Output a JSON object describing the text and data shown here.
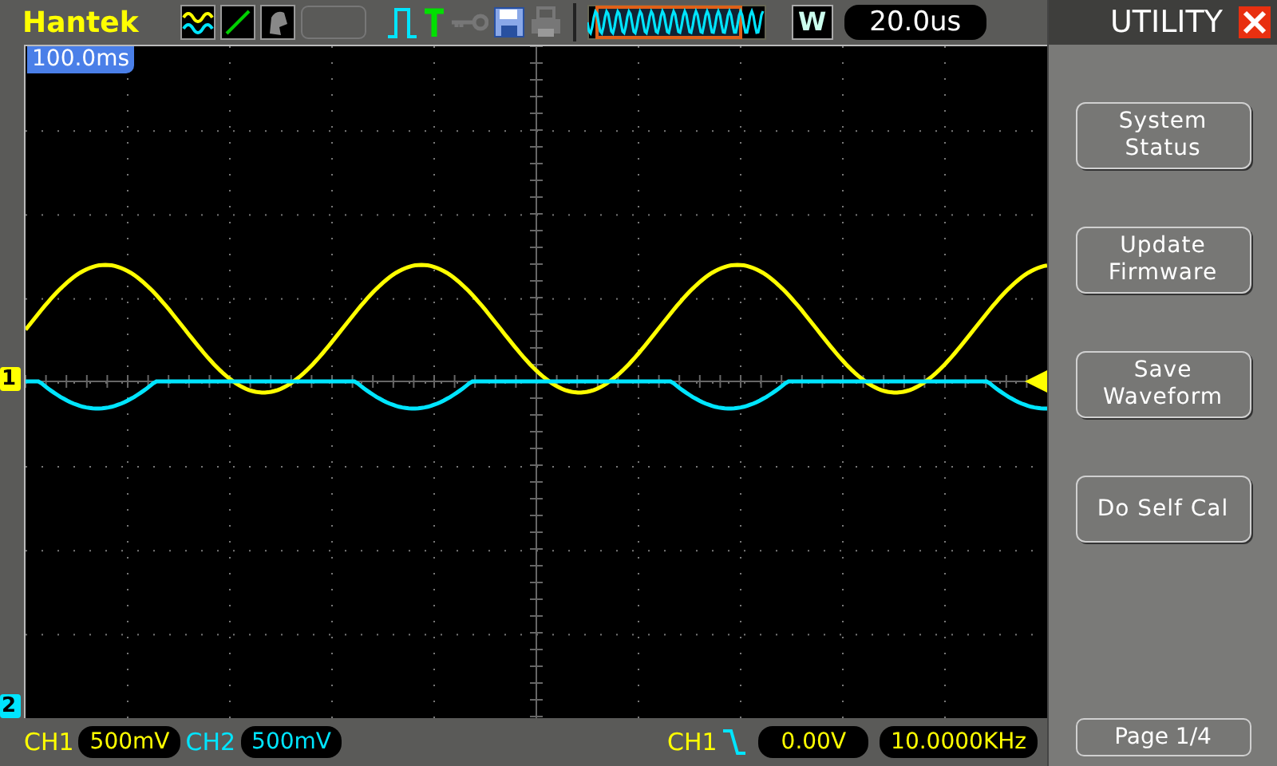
{
  "header": {
    "brand": "Hantek",
    "window_mode": "W",
    "timebase": "20.0us",
    "trigger_position": "100.0ms"
  },
  "channels": [
    {
      "label": "CH1",
      "scale": "500mV",
      "marker": "1",
      "color": "#ffff00"
    },
    {
      "label": "CH2",
      "scale": "500mV",
      "marker": "2",
      "color": "#00e5ff"
    }
  ],
  "trigger": {
    "source": "CH1",
    "level": "0.00V",
    "frequency": "10.0000KHz"
  },
  "menu": {
    "title": "UTILITY",
    "buttons": [
      "System Status",
      "Update Firmware",
      "Save Waveform",
      "Do Self Cal"
    ],
    "page": "Page 1/4"
  }
}
